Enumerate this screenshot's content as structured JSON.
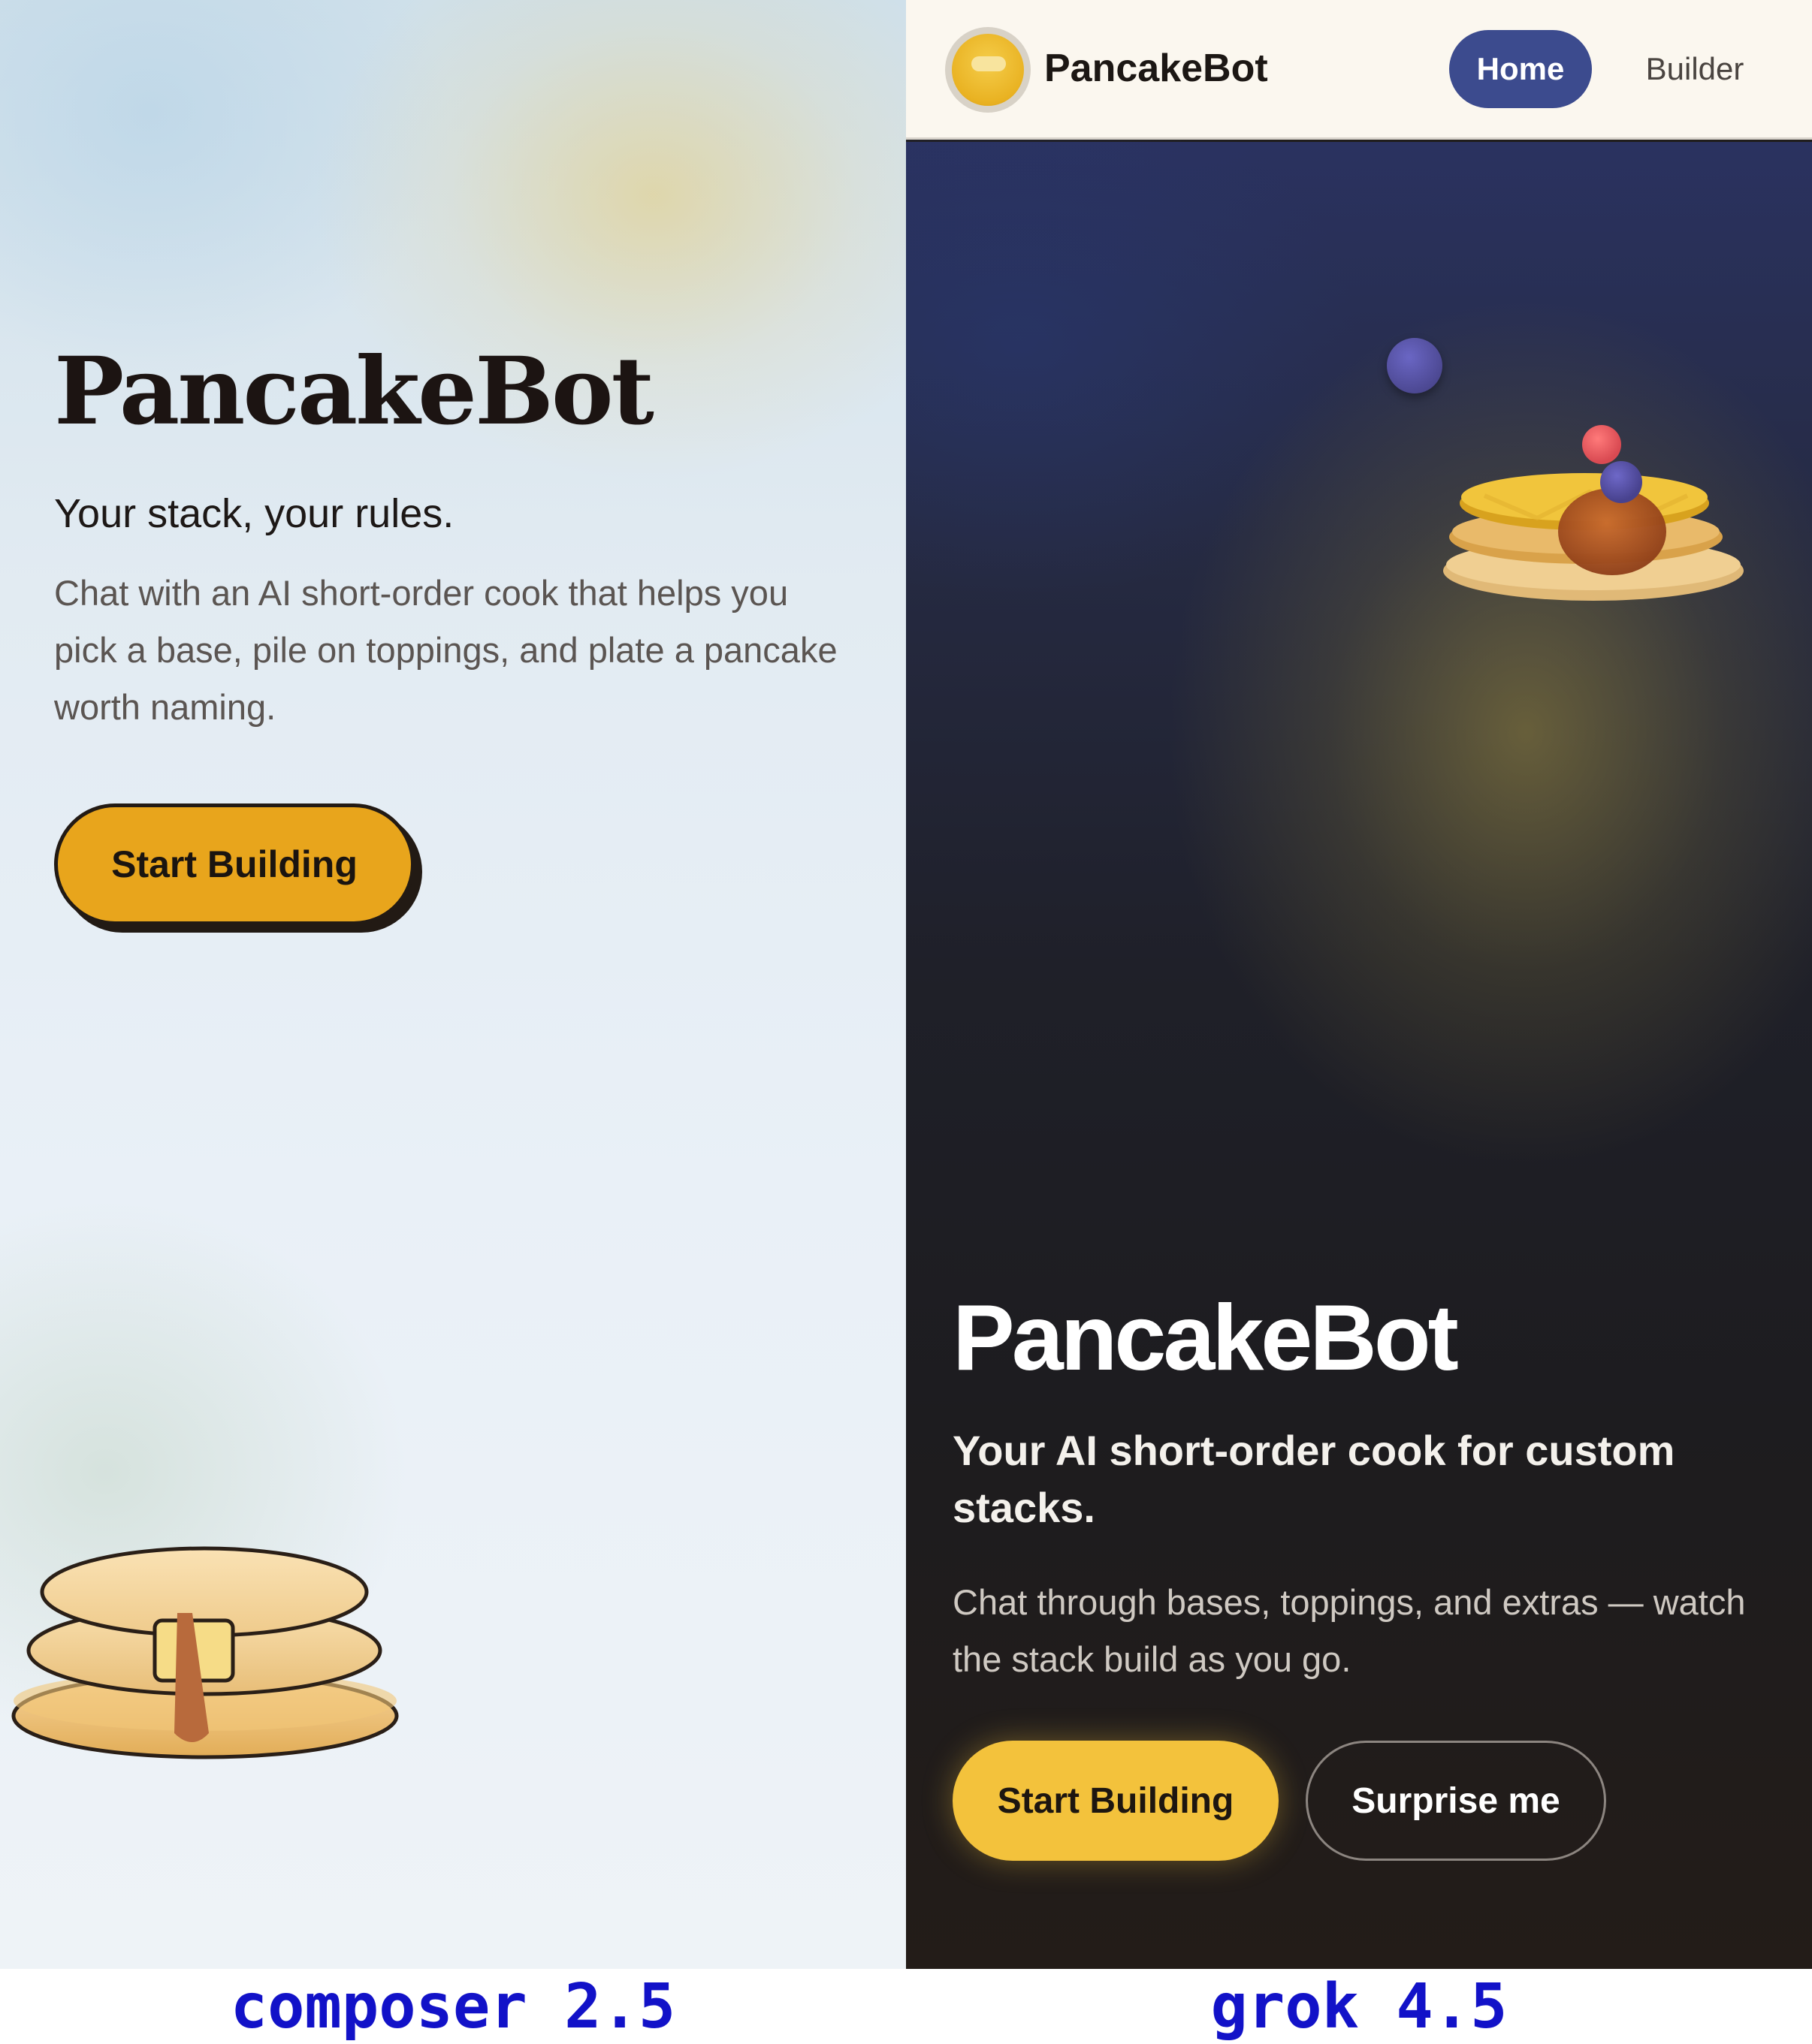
{
  "left_panel": {
    "title": "PancakeBot",
    "subtitle": "Your stack, your rules.",
    "description": "Chat with an AI short-order cook that helps you pick a base, pile on toppings, and plate a pancake worth naming.",
    "cta_label": "Start Building",
    "illustration_icon": "pancake-stack-with-syrup-icon"
  },
  "right_panel": {
    "nav": {
      "logo_icon": "pancake-logo-icon",
      "brand": "PancakeBot",
      "items": [
        {
          "label": "Home",
          "active": true
        },
        {
          "label": "Builder",
          "active": false
        }
      ]
    },
    "hero": {
      "title": "PancakeBot",
      "subtitle": "Your AI short-order cook for custom stacks.",
      "description": "Chat through bases, toppings, and extras — watch the stack build as you go.",
      "primary_label": "Start Building",
      "secondary_label": "Surprise me",
      "illustration_icon": "pancake-stack-with-berries-icon"
    }
  },
  "captions": {
    "left": "composer 2.5",
    "right": "grok 4.5"
  },
  "colors": {
    "left_cta": "#e8a51c",
    "right_cta": "#f3c23c",
    "nav_active": "#3c4b8e",
    "caption": "#1212c8"
  }
}
